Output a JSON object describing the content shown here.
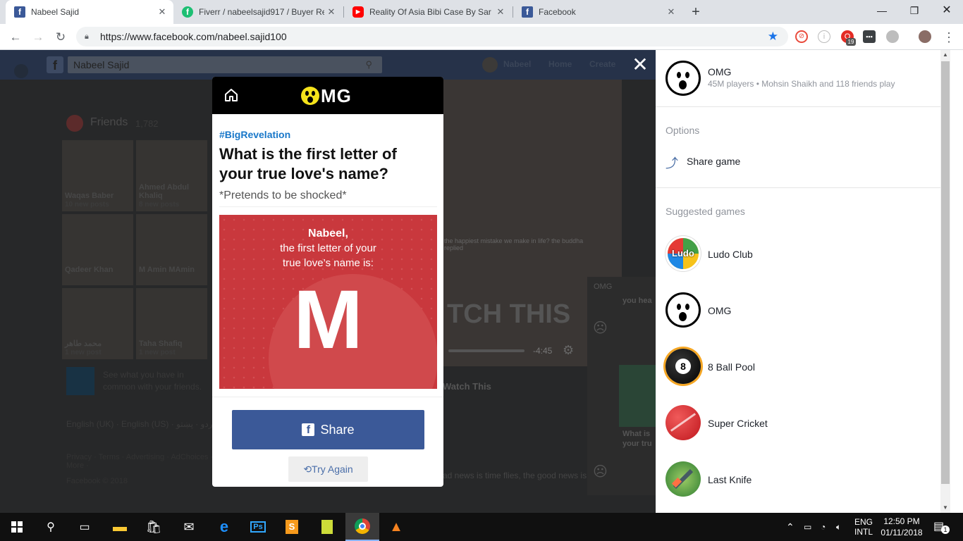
{
  "browser": {
    "tabs": [
      {
        "title": "Nabeel Sajid",
        "favicon": "facebook-icon",
        "color": "#3b5998"
      },
      {
        "title": "Fiverr / nabeelsajid917 / Buyer Re",
        "favicon": "fiverr-icon",
        "color": "#1dbf73"
      },
      {
        "title": "Reality Of Asia Bibi Case By Sar e",
        "favicon": "youtube-icon",
        "color": "#ff0000"
      },
      {
        "title": "Facebook",
        "favicon": "facebook-icon",
        "color": "#3b5998"
      }
    ],
    "url": "https://www.facebook.com/nabeel.sajid100",
    "ext_badge": "19"
  },
  "facebook": {
    "search_value": "Nabeel Sajid",
    "nav": {
      "name": "Nabeel",
      "home": "Home",
      "create": "Create"
    },
    "friends": {
      "title": "Friends",
      "count": "1,782"
    },
    "friend_tiles": [
      {
        "name": "Waqas Baber",
        "posts": "10 new posts"
      },
      {
        "name": "Ahmed Abdul Khaliq",
        "posts": "8 new posts"
      },
      {
        "name": "Qadeer Khan",
        "posts": ""
      },
      {
        "name": "M Amin MAmin",
        "posts": ""
      },
      {
        "name": "محمد طاهر",
        "posts": "1 new post"
      },
      {
        "name": "Taha Shafiq",
        "posts": "1 new post"
      }
    ],
    "common_text": "See what you have in common with your friends.",
    "languages": "English (UK) · English (US) · اردو · پښتو",
    "footer_links": "Privacy · Terms · Advertising · AdChoices · More ·",
    "copyright": "Facebook © 2018",
    "video_title": "Watch This",
    "video_big": "TCH THIS",
    "video_time": "-4:45",
    "video_caption": "the happiest mistake we make in life? the buddha replied",
    "bottom_text": "ad news is time flies, the good news is",
    "side_label": "OMG",
    "side_text1": "you hea",
    "side_text2": "What is your tru"
  },
  "game_modal": {
    "brand": "OMG",
    "hashtag": "#BigRevelation",
    "question": "What is the first letter of your true love's name?",
    "subtitle": "*Pretends to be shocked*",
    "result_name": "Nabeel,",
    "result_line1": "the first letter of your",
    "result_line2": "true love’s name is:",
    "result_letter": "M",
    "share_label": "Share",
    "retry_label": "Try Again"
  },
  "side_panel": {
    "game_name": "OMG",
    "game_stats": "45M players • Mohsin Shaikh and 118 friends play",
    "options_label": "Options",
    "share_game": "Share game",
    "suggested_label": "Suggested games",
    "suggested": [
      {
        "name": "Ludo Club",
        "icon": "ludo-club-icon"
      },
      {
        "name": "OMG",
        "icon": "omg-icon"
      },
      {
        "name": "8 Ball Pool",
        "icon": "8-ball-pool-icon"
      },
      {
        "name": "Super Cricket",
        "icon": "cricket-ball-icon"
      },
      {
        "name": "Last Knife",
        "icon": "last-knife-icon"
      }
    ]
  },
  "taskbar": {
    "lang1": "ENG",
    "lang2": "INTL",
    "time": "12:50 PM",
    "date": "01/11/2018",
    "notif_count": "1"
  }
}
